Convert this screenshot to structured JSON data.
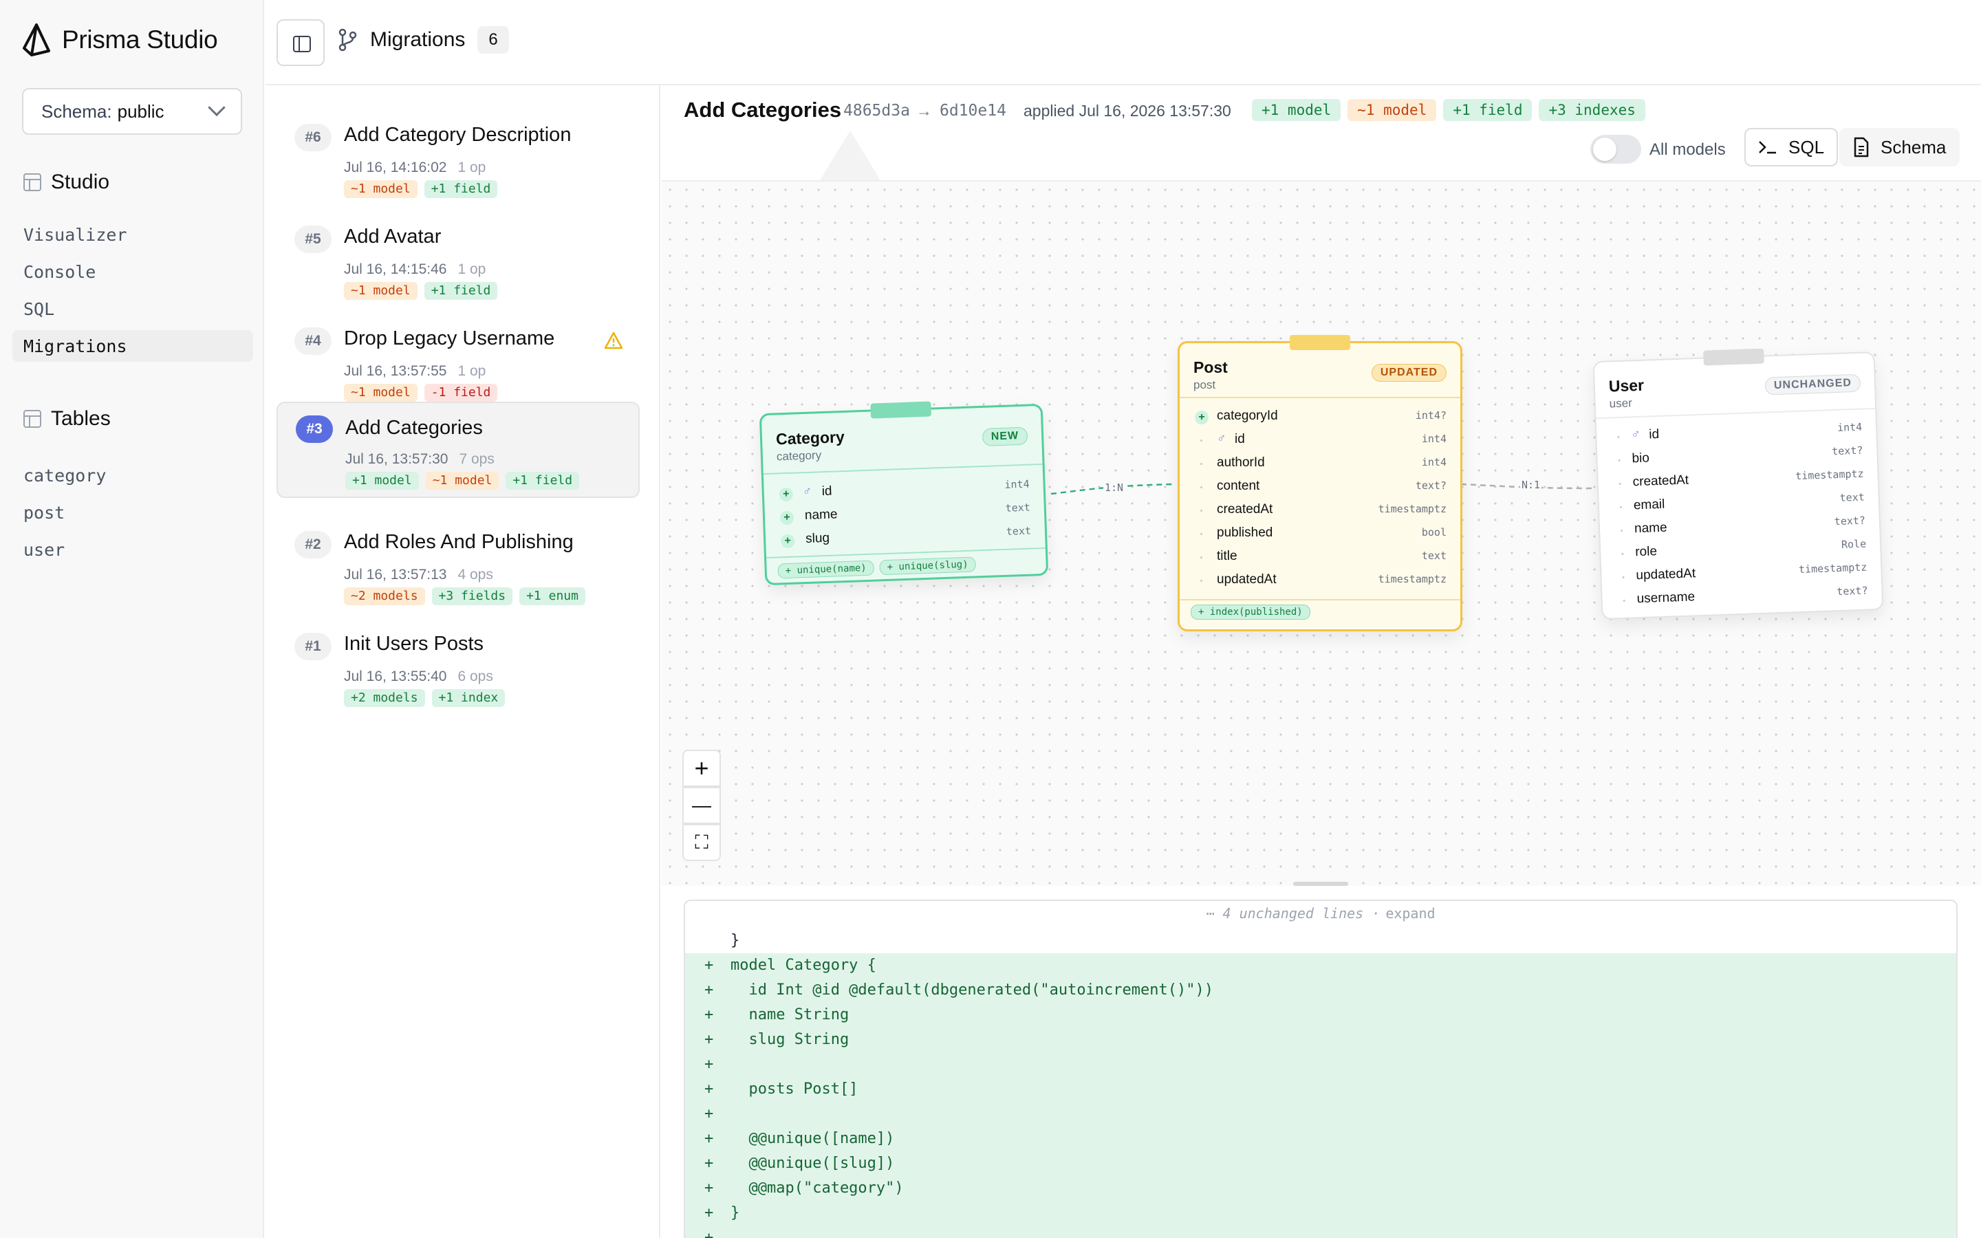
{
  "sidebar": {
    "brand": "Prisma Studio",
    "schema_label": "Schema:",
    "schema_value": "public",
    "studio_heading": "Studio",
    "studio_items": [
      "Visualizer",
      "Console",
      "SQL",
      "Migrations"
    ],
    "active_item": "Migrations",
    "tables_heading": "Tables",
    "tables": [
      "category",
      "post",
      "user"
    ]
  },
  "topbar": {
    "title": "Migrations",
    "count": "6"
  },
  "migrations": [
    {
      "num": "#6",
      "title": "Add Category Description",
      "time": "Jul 16, 14:16:02",
      "ops": "1 op",
      "tags": [
        {
          "text": "~1 model",
          "kind": "orange"
        },
        {
          "text": "+1 field",
          "kind": "green"
        }
      ]
    },
    {
      "num": "#5",
      "title": "Add Avatar",
      "time": "Jul 16, 14:15:46",
      "ops": "1 op",
      "tags": [
        {
          "text": "~1 model",
          "kind": "orange"
        },
        {
          "text": "+1 field",
          "kind": "green"
        }
      ]
    },
    {
      "num": "#4",
      "title": "Drop Legacy Username",
      "time": "Jul 16, 13:57:55",
      "ops": "1 op",
      "warning": true,
      "tags": [
        {
          "text": "~1 model",
          "kind": "orange"
        },
        {
          "text": "-1 field",
          "kind": "red"
        }
      ]
    },
    {
      "num": "#3",
      "title": "Add Categories",
      "time": "Jul 16, 13:57:30",
      "ops": "7 ops",
      "selected": true,
      "tags": [
        {
          "text": "+1 model",
          "kind": "green"
        },
        {
          "text": "~1 model",
          "kind": "orange"
        },
        {
          "text": "+1 field",
          "kind": "green"
        }
      ]
    },
    {
      "num": "#2",
      "title": "Add Roles And Publishing",
      "time": "Jul 16, 13:57:13",
      "ops": "4 ops",
      "tags": [
        {
          "text": "~2 models",
          "kind": "orange"
        },
        {
          "text": "+3 fields",
          "kind": "green"
        },
        {
          "text": "+1 enum",
          "kind": "green"
        }
      ]
    },
    {
      "num": "#1",
      "title": "Init Users Posts",
      "time": "Jul 16, 13:55:40",
      "ops": "6 ops",
      "tags": [
        {
          "text": "+2 models",
          "kind": "green"
        },
        {
          "text": "+1 index",
          "kind": "green"
        }
      ]
    }
  ],
  "detail": {
    "title": "Add Categories",
    "from_hash": "4865d3a",
    "arrow": "→",
    "to_hash": "6d10e14",
    "applied": "applied Jul 16, 2026 13:57:30",
    "tags": [
      {
        "text": "+1 model",
        "kind": "green"
      },
      {
        "text": "~1 model",
        "kind": "orange"
      },
      {
        "text": "+1 field",
        "kind": "green"
      },
      {
        "text": "+3 indexes",
        "kind": "green"
      }
    ],
    "all_models_label": "All models",
    "all_models_on": false,
    "sql_button": "SQL",
    "schema_button": "Schema"
  },
  "canvas": {
    "category": {
      "name": "Category",
      "table": "category",
      "badge": "NEW",
      "fields": [
        {
          "name": "id",
          "type": "int4",
          "key": true,
          "mark": "+"
        },
        {
          "name": "name",
          "type": "text",
          "mark": "+"
        },
        {
          "name": "slug",
          "type": "text",
          "mark": "+"
        }
      ],
      "indexes": [
        "+ unique(name)",
        "+ unique(slug)"
      ]
    },
    "post": {
      "name": "Post",
      "table": "post",
      "badge": "UPDATED",
      "fields": [
        {
          "name": "categoryId",
          "type": "int4?",
          "mark": "+"
        },
        {
          "name": "id",
          "type": "int4",
          "key": true
        },
        {
          "name": "authorId",
          "type": "int4"
        },
        {
          "name": "content",
          "type": "text?"
        },
        {
          "name": "createdAt",
          "type": "timestamptz"
        },
        {
          "name": "published",
          "type": "bool"
        },
        {
          "name": "title",
          "type": "text"
        },
        {
          "name": "updatedAt",
          "type": "timestamptz"
        }
      ],
      "indexes": [
        "+ index(published)"
      ]
    },
    "user": {
      "name": "User",
      "table": "user",
      "badge": "UNCHANGED",
      "fields": [
        {
          "name": "id",
          "type": "int4",
          "key": true
        },
        {
          "name": "bio",
          "type": "text?"
        },
        {
          "name": "createdAt",
          "type": "timestamptz"
        },
        {
          "name": "email",
          "type": "text"
        },
        {
          "name": "name",
          "type": "text?"
        },
        {
          "name": "role",
          "type": "Role"
        },
        {
          "name": "updatedAt",
          "type": "timestamptz"
        },
        {
          "name": "username",
          "type": "text?"
        }
      ]
    },
    "edge_category_post": "1:N",
    "edge_post_user": "N:1",
    "zoom_in": "+",
    "zoom_out": "—",
    "fit": "⛶"
  },
  "diff": {
    "collapsed_text": "⋯ 4 unchanged lines ·",
    "expand_label": "expand",
    "lines": [
      {
        "sign": "",
        "code": "}",
        "kind": "ctx"
      },
      {
        "sign": "+",
        "code": "model Category {",
        "kind": "add"
      },
      {
        "sign": "+",
        "code": "  id Int @id @default(dbgenerated(\"autoincrement()\"))",
        "kind": "add"
      },
      {
        "sign": "+",
        "code": "  name String",
        "kind": "add"
      },
      {
        "sign": "+",
        "code": "  slug String",
        "kind": "add"
      },
      {
        "sign": "+",
        "code": "",
        "kind": "add"
      },
      {
        "sign": "+",
        "code": "  posts Post[]",
        "kind": "add"
      },
      {
        "sign": "+",
        "code": "",
        "kind": "add"
      },
      {
        "sign": "+",
        "code": "  @@unique([name])",
        "kind": "add"
      },
      {
        "sign": "+",
        "code": "  @@unique([slug])",
        "kind": "add"
      },
      {
        "sign": "+",
        "code": "  @@map(\"category\")",
        "kind": "add"
      },
      {
        "sign": "+",
        "code": "}",
        "kind": "add"
      },
      {
        "sign": "+",
        "code": "",
        "kind": "add"
      }
    ]
  },
  "colors": {
    "accent": "#5b6ee1",
    "new_green": "#34c38f",
    "updated_amber": "#f5c242",
    "unchanged_gray": "#d1d5db"
  }
}
